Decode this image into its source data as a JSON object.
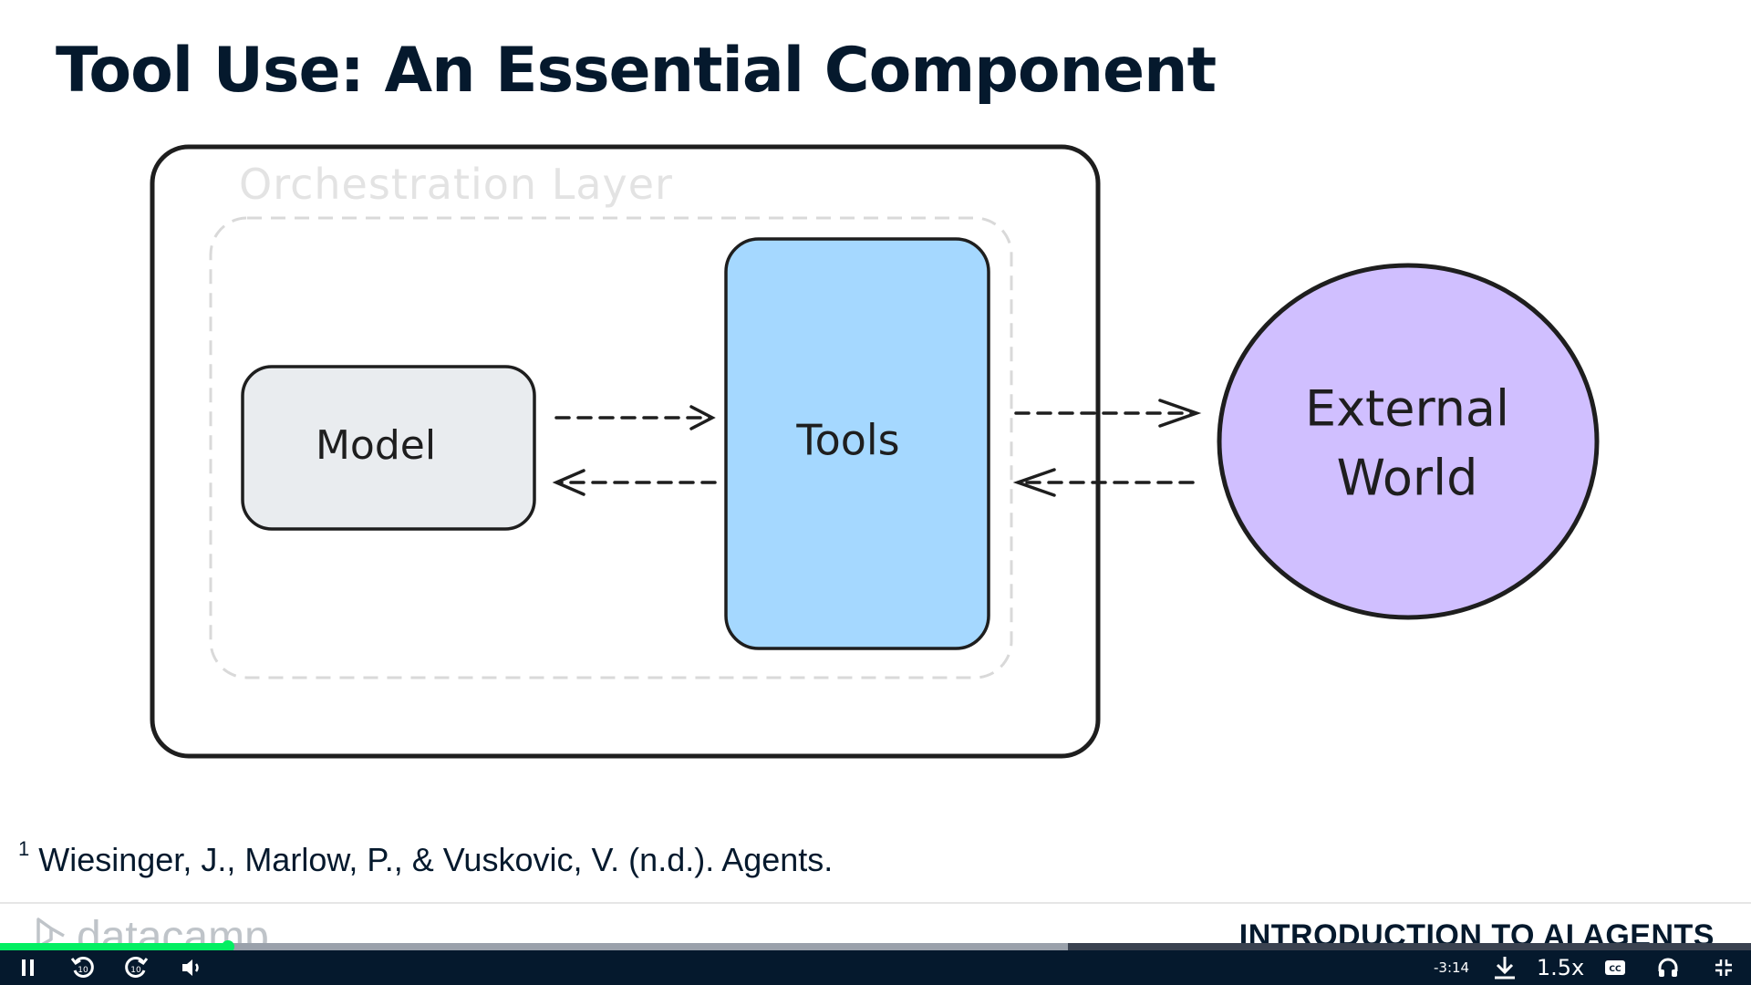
{
  "slide": {
    "title": "Tool Use: An Essential Component",
    "footnote_marker": "1",
    "footnote_text": "Wiesinger, J., Marlow, P., & Vuskovic, V. (n.d.). Agents.",
    "brand": "datacamp",
    "course_title": "INTRODUCTION TO AI AGENTS"
  },
  "diagram": {
    "container_label": "Orchestration Layer",
    "model_label": "Model",
    "tools_label": "Tools",
    "world_label_line1": "External",
    "world_label_line2": "World",
    "colors": {
      "model_fill": "#e9ecef",
      "tools_fill": "#a5d8ff",
      "world_fill": "#d0bfff",
      "stroke": "#1e1e1e",
      "dashed_border": "#d9d9d9",
      "container_label": "#e3e3e3"
    }
  },
  "player": {
    "time_remaining": "-3:14",
    "speed": "1.5x",
    "progress_fraction": 0.13,
    "buffer_fraction": 0.61,
    "accent_color": "#03ef62",
    "icons": [
      "pause-icon",
      "rewind-10-icon",
      "forward-10-icon",
      "volume-icon",
      "download-icon",
      "captions-icon",
      "headphones-icon",
      "exit-fullscreen-icon"
    ]
  }
}
